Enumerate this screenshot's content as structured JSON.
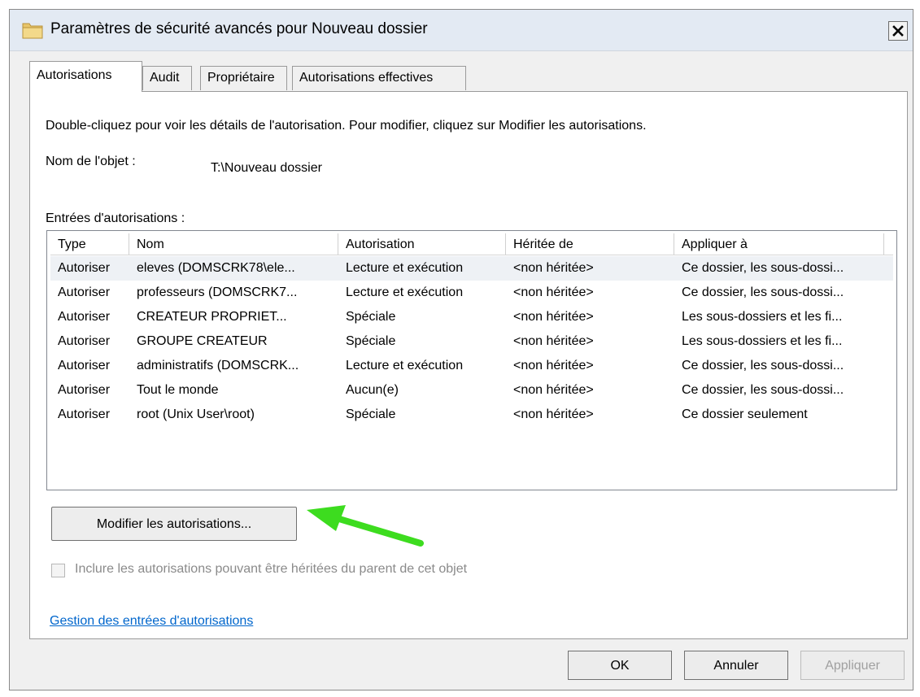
{
  "window": {
    "title": "Paramètres de sécurité avancés pour Nouveau dossier",
    "close_label": "×"
  },
  "tabs": [
    {
      "label": "Autorisations",
      "active": true
    },
    {
      "label": "Audit",
      "active": false
    },
    {
      "label": "Propriétaire",
      "active": false
    },
    {
      "label": "Autorisations effectives",
      "active": false
    }
  ],
  "panel": {
    "description": "Double-cliquez pour voir les détails de l'autorisation. Pour modifier, cliquez sur Modifier les autorisations.",
    "object_label": "Nom de l'objet :",
    "object_value": "T:\\Nouveau dossier",
    "entries_label": "Entrées d'autorisations :"
  },
  "table": {
    "headers": [
      "Type",
      "Nom",
      "Autorisation",
      "Héritée de",
      "Appliquer à"
    ],
    "rows": [
      [
        "Autoriser",
        "eleves (DOMSCRK78\\ele...",
        "Lecture et exécution",
        "<non héritée>",
        "Ce dossier, les sous-dossi..."
      ],
      [
        "Autoriser",
        "professeurs (DOMSCRK7...",
        "Lecture et exécution",
        "<non héritée>",
        "Ce dossier, les sous-dossi..."
      ],
      [
        "Autoriser",
        "CREATEUR PROPRIET...",
        "Spéciale",
        "<non héritée>",
        "Les sous-dossiers et les fi..."
      ],
      [
        "Autoriser",
        "GROUPE CREATEUR",
        "Spéciale",
        "<non héritée>",
        "Les sous-dossiers et les fi..."
      ],
      [
        "Autoriser",
        "administratifs (DOMSCRK...",
        "Lecture et exécution",
        "<non héritée>",
        "Ce dossier, les sous-dossi..."
      ],
      [
        "Autoriser",
        "Tout le monde",
        "Aucun(e)",
        "<non héritée>",
        "Ce dossier, les sous-dossi..."
      ],
      [
        "Autoriser",
        "root (Unix User\\root)",
        "Spéciale",
        "<non héritée>",
        "Ce dossier seulement"
      ]
    ]
  },
  "modify_button_label": "Modifier les autorisations...",
  "inherit_checkbox": {
    "label": "Inclure les autorisations pouvant être héritées du parent de cet objet",
    "checked": false,
    "enabled": false
  },
  "manage_link": "Gestion des entrées d'autorisations",
  "buttons": {
    "ok": "OK",
    "cancel": "Annuler",
    "apply": "Appliquer"
  },
  "colors": {
    "title_bar": "#e3eaf3",
    "link": "#0066cc",
    "arrow": "#3ddc1f",
    "selected_row": "#eef1f5"
  }
}
